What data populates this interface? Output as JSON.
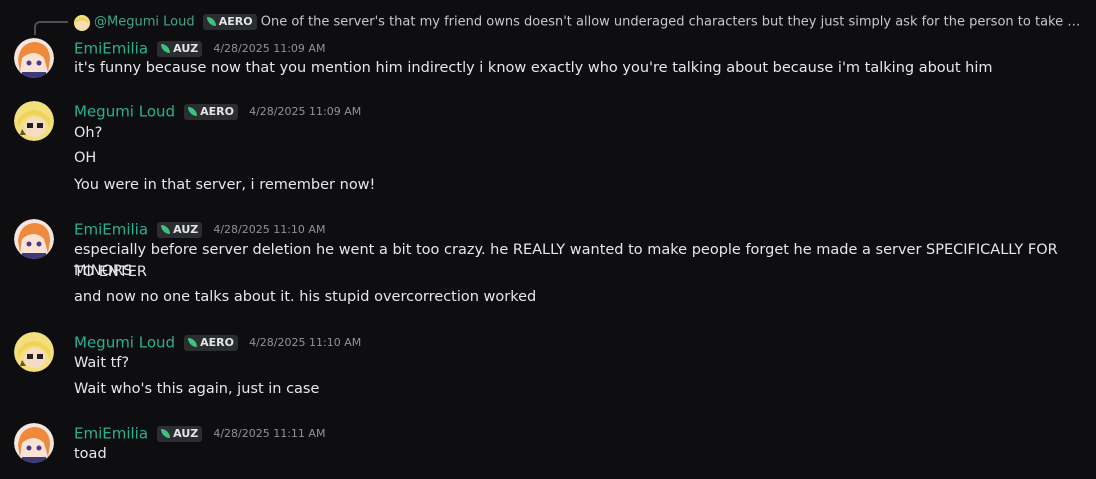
{
  "reply": {
    "author": "@Megumi Loud",
    "tag": "AERO",
    "preview": "One of the server's that my friend owns doesn't allow underaged characters but they just simply ask for the person to take the images do..."
  },
  "messages": [
    {
      "author": "EmiEmilia",
      "tag": "AUZ",
      "time": "4/28/2025 11:09 AM",
      "lines": [
        "it's funny because now that you mention him indirectly i know exactly who you're talking about because i'm talking about him"
      ]
    },
    {
      "author": "Megumi Loud",
      "tag": "AERO",
      "time": "4/28/2025 11:09 AM",
      "lines": [
        "Oh?",
        "OH",
        "You were in that server, i remember now!"
      ]
    },
    {
      "author": "EmiEmilia",
      "tag": "AUZ",
      "time": "4/28/2025 11:10 AM",
      "lines": [
        "especially before server deletion he went a bit too crazy. he REALLY wanted to make people forget he made a server SPECIFICALLY FOR MINORS",
        "TO ENTER",
        "and now no one talks about it. his stupid overcorrection worked"
      ]
    },
    {
      "author": "Megumi Loud",
      "tag": "AERO",
      "time": "4/28/2025 11:10 AM",
      "lines": [
        "Wait tf?",
        "Wait who's this again, just in case"
      ]
    },
    {
      "author": "EmiEmilia",
      "tag": "AUZ",
      "time": "4/28/2025 11:11 AM",
      "lines": [
        "toad"
      ]
    }
  ],
  "colors": {
    "background": "#0e0e10",
    "author": "#2bb091",
    "tag_leaf": "#3ac47d",
    "timestamp": "#8e9297"
  }
}
